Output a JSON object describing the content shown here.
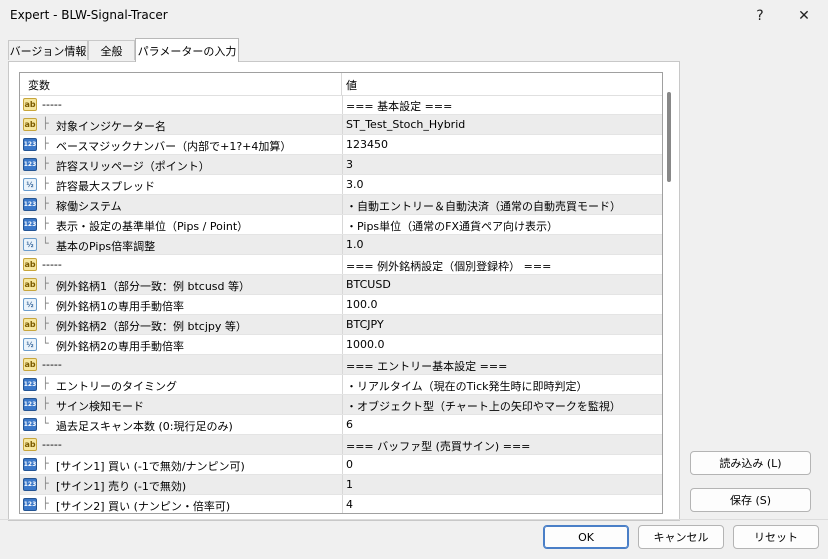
{
  "window": {
    "title": "Expert - BLW-Signal-Tracer",
    "help_label": "?",
    "close_label": "✕"
  },
  "tabs": [
    {
      "label": "バージョン情報"
    },
    {
      "label": "全般"
    },
    {
      "label": "パラメーターの入力"
    }
  ],
  "grid": {
    "columns": {
      "name": "変数",
      "value": "値"
    },
    "rows": [
      {
        "icon": "ab",
        "name": "-----",
        "value": "=== 基本設定 ===",
        "sep": true
      },
      {
        "icon": "ab",
        "name": "対象インジケーター名",
        "value": "ST_Test_Stoch_Hybrid"
      },
      {
        "icon": "123",
        "name": "ベースマジックナンバー（内部で+1?+4加算）",
        "value": "123450"
      },
      {
        "icon": "123",
        "name": "許容スリッページ（ポイント）",
        "value": "3"
      },
      {
        "icon": "half",
        "name": "許容最大スプレッド",
        "value": "3.0"
      },
      {
        "icon": "123",
        "name": "稼働システム",
        "value": "・自動エントリー＆自動決済（通常の自動売買モード）"
      },
      {
        "icon": "123",
        "name": "表示・設定の基準単位（Pips / Point）",
        "value": "・Pips単位（通常のFX通貨ペア向け表示）"
      },
      {
        "icon": "half",
        "name": "基本のPips倍率調整",
        "value": "1.0",
        "last": true
      },
      {
        "icon": "ab",
        "name": "-----",
        "value": "=== 例外銘柄設定（個別登録枠） ===",
        "sep": true
      },
      {
        "icon": "ab",
        "name": "例外銘柄1（部分一致：例 btcusd 等）",
        "value": "BTCUSD"
      },
      {
        "icon": "half",
        "name": "例外銘柄1の専用手動倍率",
        "value": "100.0"
      },
      {
        "icon": "ab",
        "name": "例外銘柄2（部分一致：例 btcjpy 等）",
        "value": "BTCJPY"
      },
      {
        "icon": "half",
        "name": "例外銘柄2の専用手動倍率",
        "value": "1000.0",
        "last": true
      },
      {
        "icon": "ab",
        "name": "-----",
        "value": "=== エントリー基本設定 ===",
        "sep": true
      },
      {
        "icon": "123",
        "name": "エントリーのタイミング",
        "value": "・リアルタイム（現在のTick発生時に即時判定）"
      },
      {
        "icon": "123",
        "name": "サイン検知モード",
        "value": "・オブジェクト型（チャート上の矢印やマークを監視）"
      },
      {
        "icon": "123",
        "name": "過去足スキャン本数 (0:現行足のみ)",
        "value": "6",
        "last": true
      },
      {
        "icon": "ab",
        "name": "-----",
        "value": "=== バッファ型 (売買サイン) ===",
        "sep": true
      },
      {
        "icon": "123",
        "name": "[サイン1] 買い (-1で無効/ナンピン可)",
        "value": "0"
      },
      {
        "icon": "123",
        "name": "[サイン1] 売り (-1で無効)",
        "value": "1"
      },
      {
        "icon": "123",
        "name": "[サイン2] 買い (ナンピン・倍率可)",
        "value": "4"
      }
    ]
  },
  "side_buttons": {
    "load": "読み込み (L)",
    "save": "保存 (S)"
  },
  "bottom_buttons": {
    "ok": "OK",
    "cancel": "キャンセル",
    "reset": "リセット"
  }
}
